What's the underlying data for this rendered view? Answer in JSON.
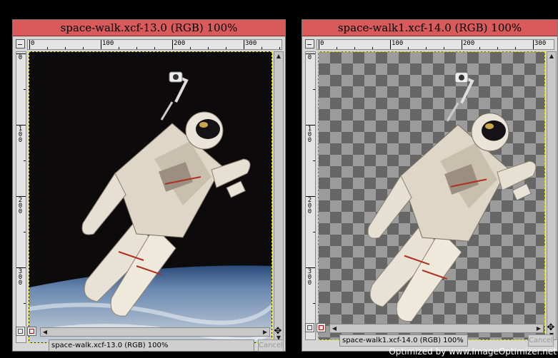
{
  "windows": [
    {
      "title": "space-walk.xcf-13.0 (RGB) 100%",
      "ruler_h": [
        "0",
        "100",
        "200",
        "300"
      ],
      "ruler_v": [
        "0",
        "100",
        "200",
        "300"
      ],
      "status": "space-walk.xcf-13.0 (RGB) 100%",
      "cancel_label": "Cancel",
      "background": "black space with Earth horizon"
    },
    {
      "title": "space-walk1.xcf-14.0 (RGB) 100%",
      "ruler_h": [
        "0",
        "100",
        "200",
        "300"
      ],
      "ruler_v": [
        "0",
        "100",
        "200",
        "300"
      ],
      "status": "space-walk1.xcf-14.0 (RGB) 100%",
      "cancel_label": "Cancel",
      "background": "transparency checkerboard"
    }
  ],
  "watermark": "Optimized by www.ImageOptimizer.net",
  "colors": {
    "titlebar": "#d95a5a",
    "window_bg": "#d6d6d6",
    "desktop": "#000000",
    "selection_marching_ants": "#e8e000"
  }
}
